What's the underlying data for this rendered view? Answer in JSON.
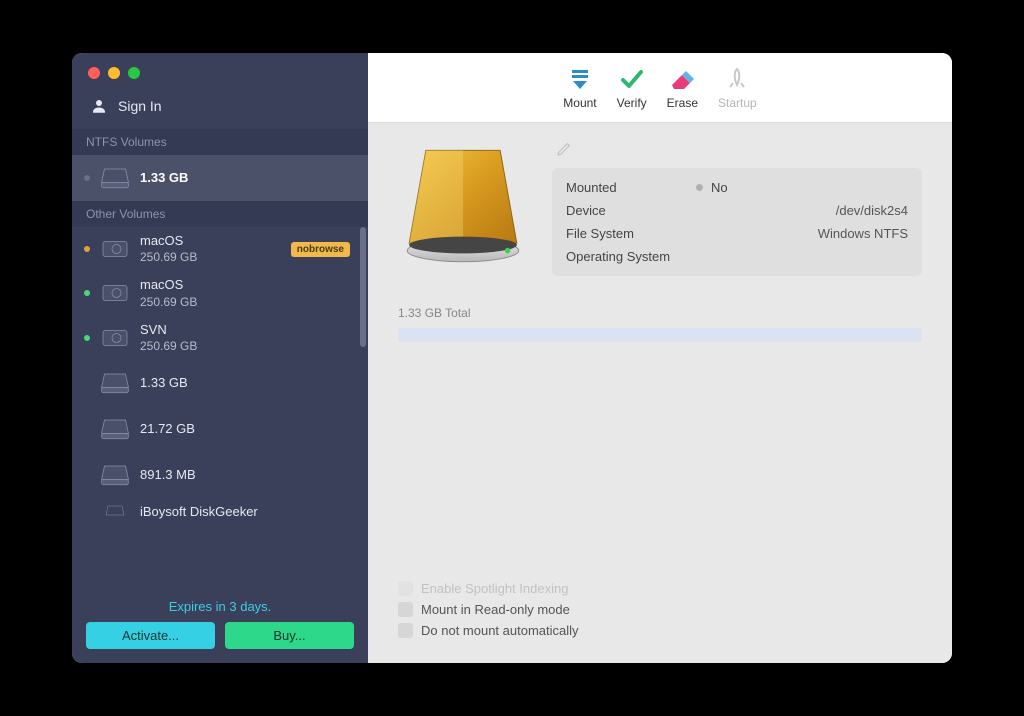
{
  "signin_label": "Sign In",
  "sections": {
    "ntfs_header": "NTFS Volumes",
    "other_header": "Other Volumes"
  },
  "ntfs_volumes": [
    {
      "title": "",
      "subtitle": "1.33 GB",
      "dot": "gray",
      "selected": true
    }
  ],
  "other_volumes": [
    {
      "title": "macOS",
      "subtitle": "250.69 GB",
      "dot": "orange",
      "badge": "nobrowse"
    },
    {
      "title": "macOS",
      "subtitle": "250.69 GB",
      "dot": "green"
    },
    {
      "title": "SVN",
      "subtitle": "250.69 GB",
      "dot": "green"
    },
    {
      "title": "",
      "subtitle": "1.33 GB",
      "dot": "none"
    },
    {
      "title": "",
      "subtitle": "21.72 GB",
      "dot": "none"
    },
    {
      "title": "",
      "subtitle": "891.3 MB",
      "dot": "none"
    },
    {
      "title": "iBoysoft DiskGeeker",
      "subtitle": "",
      "dot": "none"
    }
  ],
  "expires_text": "Expires in 3 days.",
  "activate_label": "Activate...",
  "buy_label": "Buy...",
  "toolbar": {
    "mount": "Mount",
    "verify": "Verify",
    "erase": "Erase",
    "startup": "Startup"
  },
  "info": {
    "mounted_label": "Mounted",
    "mounted_value": "No",
    "device_label": "Device",
    "device_value": "/dev/disk2s4",
    "fs_label": "File System",
    "fs_value": "Windows NTFS",
    "os_label": "Operating System",
    "os_value": ""
  },
  "total_text": "1.33 GB Total",
  "options": {
    "spotlight": "Enable Spotlight Indexing",
    "readonly": "Mount in Read-only mode",
    "noauto": "Do not mount automatically"
  }
}
